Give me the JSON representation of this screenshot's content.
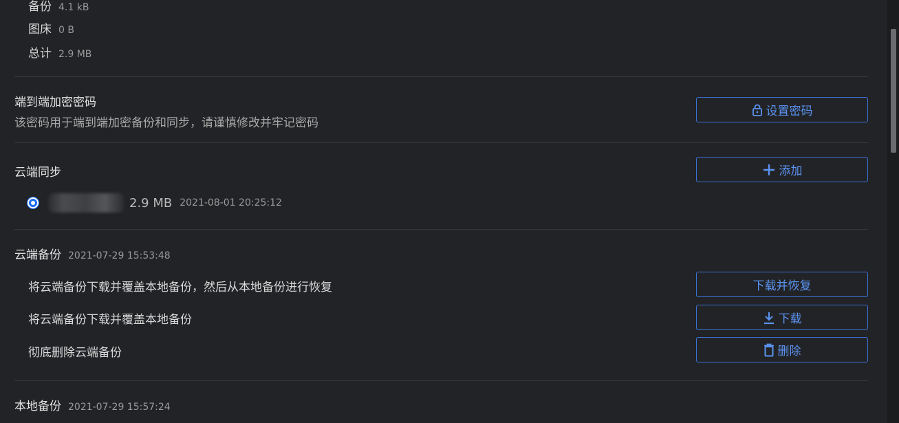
{
  "stats": [
    {
      "label": "备份",
      "value": "4.1 kB"
    },
    {
      "label": "图床",
      "value": "0 B"
    },
    {
      "label": "总计",
      "value": "2.9 MB"
    }
  ],
  "e2e": {
    "title": "端到端加密密码",
    "description": "该密码用于端到端加密备份和同步，请谨慎修改并牢记密码",
    "button_label": "设置密码",
    "button_icon": "lock-icon"
  },
  "cloud_sync": {
    "title": "云端同步",
    "add_label": "添加",
    "add_icon": "plus-icon",
    "entry": {
      "size": "2.9 MB",
      "date": "2021-08-01 20:25:12"
    }
  },
  "cloud_backup": {
    "title": "云端备份",
    "time": "2021-07-29 15:53:48",
    "actions": [
      {
        "text": "将云端备份下载并覆盖本地备份，然后从本地备份进行恢复",
        "button": "下载并恢复"
      },
      {
        "text": "将云端备份下载并覆盖本地备份",
        "button": "下载",
        "icon": "download-icon"
      },
      {
        "text": "彻底删除云端备份",
        "button": "删除",
        "icon": "trash-icon"
      }
    ]
  },
  "local_backup": {
    "title": "本地备份",
    "time": "2021-07-29 15:57:24"
  },
  "colors": {
    "accent": "#3b73d8",
    "background": "#222326",
    "divider": "#37383c"
  }
}
